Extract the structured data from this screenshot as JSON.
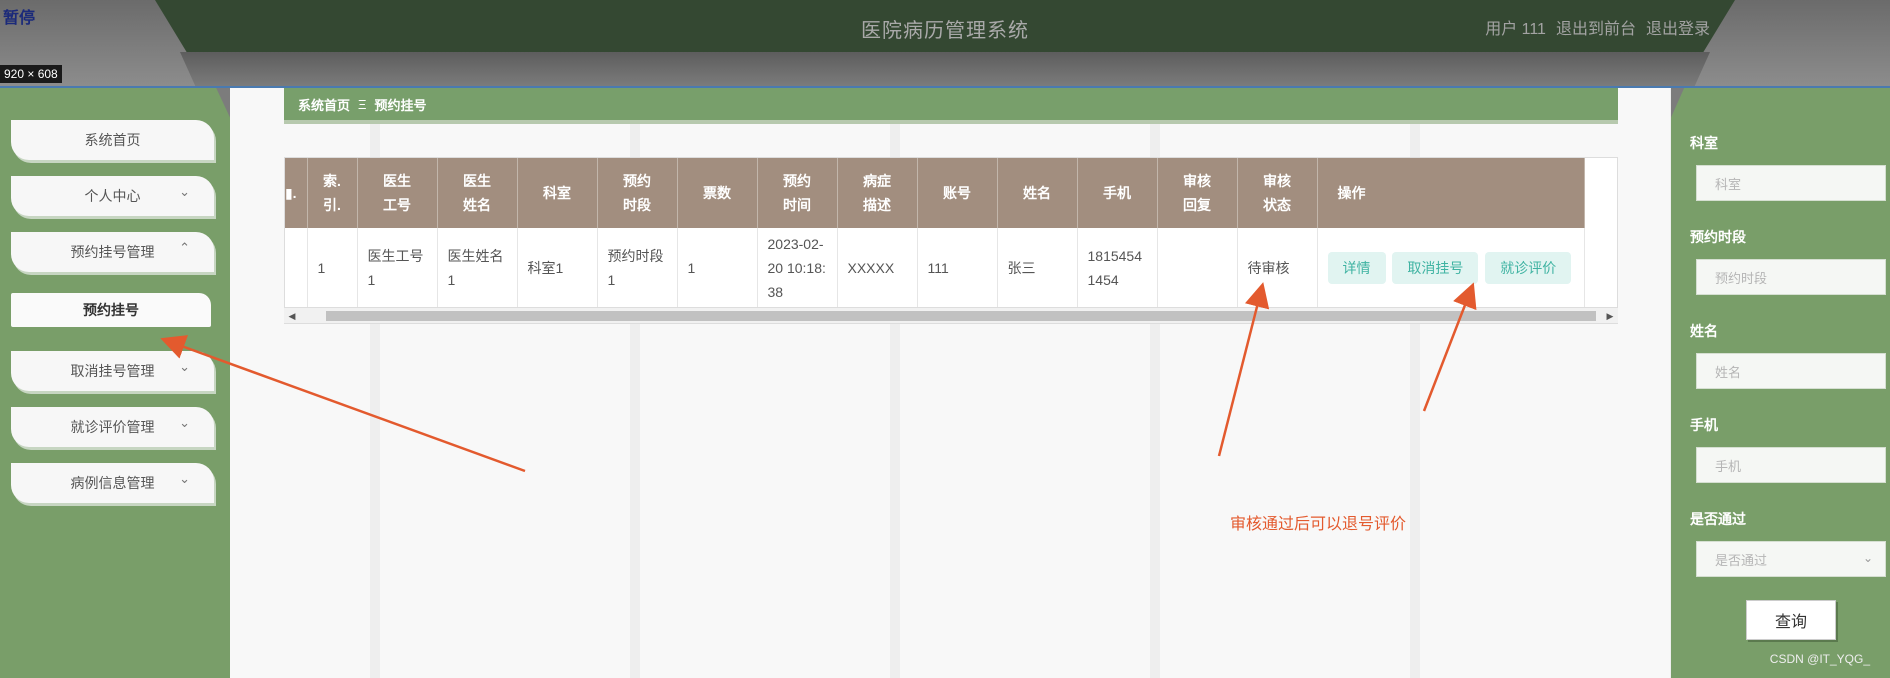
{
  "header": {
    "title": "医院病历管理系统",
    "user_label": "用户 111",
    "back_label": "退出到前台",
    "logout_label": "退出登录",
    "pause_label": "暂停",
    "dimension_tag": "920 × 608"
  },
  "sidebar": {
    "items": [
      {
        "label": "系统首页",
        "chevron": ""
      },
      {
        "label": "个人中心",
        "chevron": "⌄"
      },
      {
        "label": "预约挂号管理",
        "chevron": "⌃"
      },
      {
        "label": "取消挂号管理",
        "chevron": "⌄"
      },
      {
        "label": "就诊评价管理",
        "chevron": "⌄"
      },
      {
        "label": "病例信息管理",
        "chevron": "⌄"
      }
    ],
    "active_submenu": "预约挂号"
  },
  "breadcrumb": {
    "home": "系统首页",
    "separator": "Ξ",
    "current": "预约挂号"
  },
  "table": {
    "headers": [
      "索引",
      "医生工号",
      "医生姓名",
      "科室",
      "预约时段",
      "票数",
      "预约时间",
      "病症描述",
      "账号",
      "姓名",
      "手机",
      "审核回复",
      "审核状态",
      "操作"
    ],
    "header_lines": [
      [
        "索.",
        "引."
      ],
      [
        "医生",
        "工号"
      ],
      [
        "医生",
        "姓名"
      ],
      [
        "科室"
      ],
      [
        "预约",
        "时段"
      ],
      [
        "票数"
      ],
      [
        "预约",
        "时间"
      ],
      [
        "病症",
        "描述"
      ],
      [
        "账号"
      ],
      [
        "姓名"
      ],
      [
        "手机"
      ],
      [
        "审核",
        "回复"
      ],
      [
        "审核",
        "状态"
      ],
      [
        "操作"
      ]
    ],
    "rows": [
      {
        "index": "1",
        "doctor_id": "医生工号1",
        "doctor_name": "医生姓名1",
        "department": "科室1",
        "time_slot": "预约时段1",
        "tickets": "1",
        "appointment_time": "2023-02-20 10:18:38",
        "symptom": "XXXXX",
        "account": "111",
        "name": "张三",
        "phone": "18154541454",
        "review_reply": "",
        "review_status": "待审核"
      }
    ],
    "actions": [
      "详情",
      "取消挂号",
      "就诊评价"
    ]
  },
  "search_panel": {
    "fields": [
      {
        "label": "科室",
        "placeholder": "科室"
      },
      {
        "label": "预约时段",
        "placeholder": "预约时段"
      },
      {
        "label": "姓名",
        "placeholder": "姓名"
      },
      {
        "label": "手机",
        "placeholder": "手机"
      },
      {
        "label": "是否通过",
        "placeholder": "是否通过"
      }
    ],
    "query_label": "查询"
  },
  "annotation": "审核通过后可以退号评价",
  "watermark": "CSDN @IT_YQG_",
  "colors": {
    "sidebar_green": "#799e69",
    "table_header": "#a28e7f",
    "annotation_arrow": "#e35a2e",
    "action_text": "#3fb3a2"
  }
}
